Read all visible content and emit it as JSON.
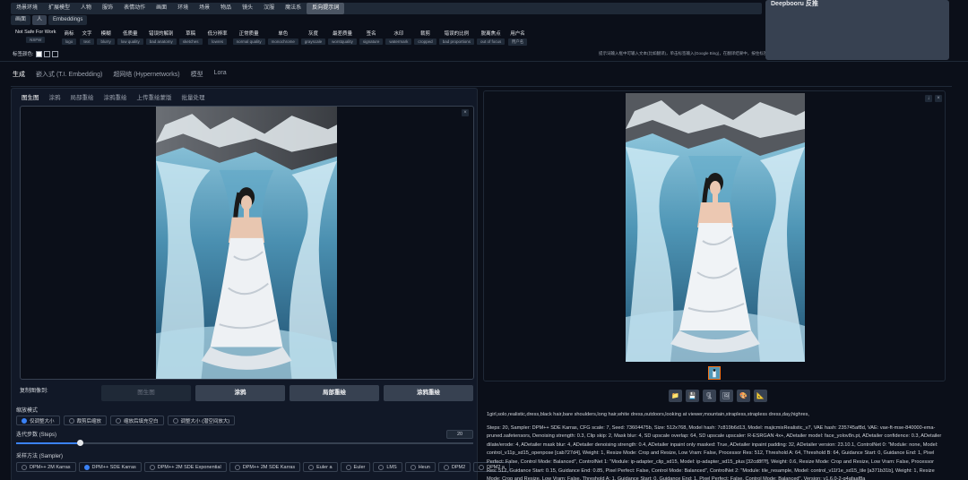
{
  "categories": [
    "场景环境",
    "扩展模型",
    "人物",
    "服饰",
    "表情动作",
    "画面",
    "环境",
    "场景",
    "物品",
    "镜头",
    "汉服",
    "魔法系",
    "反向提示词"
  ],
  "categories_active_index": 12,
  "sub_tabs": [
    "画面",
    "人",
    "Embeddings"
  ],
  "tags": [
    {
      "cn": "Not Safe For Work",
      "en": "NSFW"
    },
    {
      "cn": "商标",
      "en": "logo"
    },
    {
      "cn": "文字",
      "en": "text"
    },
    {
      "cn": "模糊",
      "en": "blurry"
    },
    {
      "cn": "低质量",
      "en": "low quality"
    },
    {
      "cn": "错误的解剖",
      "en": "bad anatomy"
    },
    {
      "cn": "草稿",
      "en": "sketches"
    },
    {
      "cn": "低分辨率",
      "en": "lowres"
    },
    {
      "cn": "正常质量",
      "en": "normal quality"
    },
    {
      "cn": "单色",
      "en": "monochrome"
    },
    {
      "cn": "灰度",
      "en": "grayscale"
    },
    {
      "cn": "最差质量",
      "en": "worstquality"
    },
    {
      "cn": "签名",
      "en": "signature"
    },
    {
      "cn": "水印",
      "en": "watermark"
    },
    {
      "cn": "裁剪",
      "en": "cropped"
    },
    {
      "cn": "错误的比例",
      "en": "bad proportions"
    },
    {
      "cn": "脱离焦点",
      "en": "out of focus"
    },
    {
      "cn": "用户名",
      "en": "用户名"
    }
  ],
  "tag_color_label": "标签颜色:",
  "hint_text": "提示词输入框中可输入文本(比如翻译)，单击标签输入(Google Bing)，在翻译结果中，按住标签可移动位置编辑",
  "right_panel_title": "Deepbooru 反推",
  "main_tabs": [
    "生成",
    "嵌入式 (T.I. Embedding)",
    "超网络 (Hypernetworks)",
    "模型",
    "Lora"
  ],
  "sub_tabs2": [
    "图生图",
    "涂鸦",
    "局部重绘",
    "涂鸦重绘",
    "上传重绘蒙版",
    "批量处理"
  ],
  "copy_label": "复制图像到:",
  "copy_buttons": [
    "图生图",
    "涂鸦",
    "局部重绘",
    "涂鸦重绘"
  ],
  "resize_label": "缩放模式",
  "resize_options": [
    "仅调整大小",
    "裁剪后缩放",
    "缩放后填充空白",
    "调整大小 (潜空间放大)"
  ],
  "steps_label": "迭代步数 (Steps)",
  "steps_value": "20",
  "steps_fraction": 0.14,
  "sampler_label": "采样方法 (Sampler)",
  "samplers": [
    "DPM++ 2M Karras",
    "DPM++ SDE Karras",
    "DPM++ 2M SDE Exponential",
    "DPM++ 2M SDE Karras",
    "Euler a",
    "Euler",
    "LMS",
    "Heun",
    "DPM2",
    "DPM2 a"
  ],
  "sampler_selected_index": 1,
  "output_tools": [
    "folder-icon",
    "save-icon",
    "zip-icon",
    "image-icon",
    "palette-icon",
    "ruler-icon"
  ],
  "info_prompt": "1girl,solo,realistic,dress,black hair,bare shoulders,long hair,white dress,outdoors,looking at viewer,mountain,strapless,strapless dress,day,highres,",
  "info_params": "Steps: 20, Sampler: DPM++ SDE Karras, CFG scale: 7, Seed: 73604475b, Size: 512x768, Model hash: 7c819b6d13, Model: majicmixRealistic_v7, VAE hash: 235745af8d, VAE: vae-ft-mse-840000-ema-pruned.safetensors, Denoising strength: 0.3, Clip skip: 2, Mask blur: 4, SD upscale overlap: 64, SD upscale upscaler: R-ESRGAN 4x+, ADetailer model: face_yolov8n.pt, ADetailer confidence: 0.3, ADetailer dilate/erode: 4, ADetailer mask blur: 4, ADetailer denoising strength: 0.4, ADetailer inpaint only masked: True, ADetailer inpaint padding: 32, ADetailer version: 23.10.1, ControlNet 0: \"Module: none, Model: control_v11p_sd15_openpose [cab727d4], Weight: 1, Resize Mode: Crop and Resize, Low Vram: False, Processor Res: 512, Threshold A: 64, Threshold B: 64, Guidance Start: 0, Guidance End: 1, Pixel Perfect: False, Control Mode: Balanced\", ControlNet 1: \"Module: ip-adapter_clip_sd15, Model: ip-adapter_sd15_plus [32cd8f7f], Weight: 0.6, Resize Mode: Crop and Resize, Low Vram: False, Processor Res: 512, Guidance Start: 0.15, Guidance End: 0.85, Pixel Perfect: False, Control Mode: Balanced\", ControlNet 2: \"Module: tile_resample, Model: control_v11f1e_sd15_tile [a371b31b], Weight: 1, Resize Mode: Crop and Resize, Low Vram: False, Threshold A: 1, Guidance Start: 0, Guidance End: 1, Pixel Perfect: False, Control Mode: Balanced\", Version: v1.6.0-2-g4afaaf8a"
}
